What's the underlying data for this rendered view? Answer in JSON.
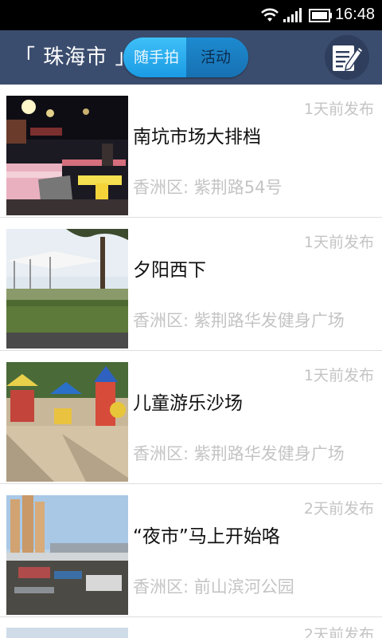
{
  "status_bar": {
    "time": "16:48"
  },
  "header": {
    "city": "「 珠海市 」",
    "tabs": [
      {
        "label": "随手拍",
        "selected": true
      },
      {
        "label": "活动",
        "selected": false
      }
    ]
  },
  "posts": [
    {
      "title": "南坑市场大排档",
      "time": "1天前发布",
      "address": "香洲区: 紫荆路54号"
    },
    {
      "title": "夕阳西下",
      "time": "1天前发布",
      "address": "香洲区: 紫荆路华发健身广场"
    },
    {
      "title": "儿童游乐沙场",
      "time": "1天前发布",
      "address": "香洲区: 紫荆路华发健身广场"
    },
    {
      "title": "“夜市”马上开始咯",
      "time": "2天前发布",
      "address": "香洲区: 前山滨河公园"
    }
  ],
  "partial_post": {
    "time": "2天前发布"
  }
}
